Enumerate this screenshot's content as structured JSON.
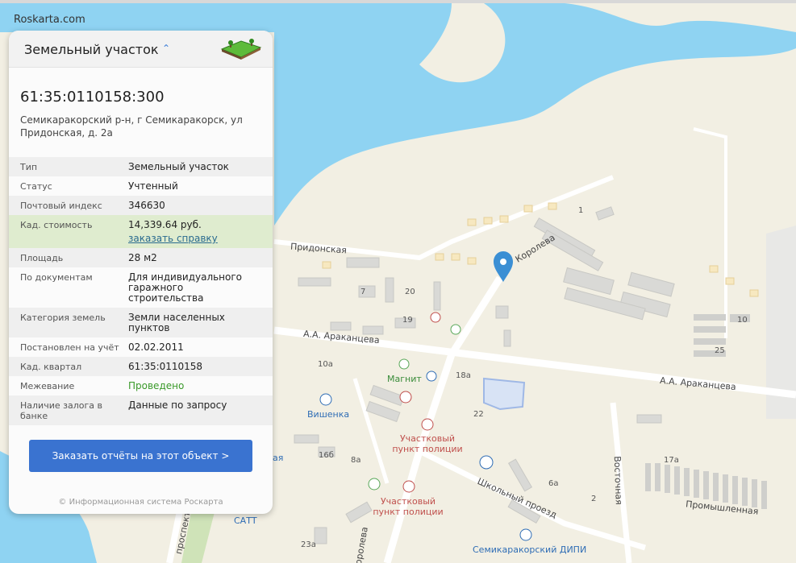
{
  "brand": "Roskarta.com",
  "panel": {
    "title": "Земельный участок",
    "cad_number": "61:35:0110158:300",
    "address": "Семикаракорский р-н, г Семикаракорск, ул Придонская, д. 2а",
    "properties": [
      {
        "label": "Тип",
        "value": "Земельный участок"
      },
      {
        "label": "Статус",
        "value": "Учтенный"
      },
      {
        "label": "Почтовый индекс",
        "value": "346630"
      },
      {
        "label": "Кад. стоимость",
        "value": "14,339.64 руб.",
        "link": "заказать справку"
      },
      {
        "label": "Площадь",
        "value": "28 м2"
      },
      {
        "label": "По документам",
        "value": "Для индивидуального гаражного строительства"
      },
      {
        "label": "Категория земель",
        "value": "Земли населенных пунктов"
      },
      {
        "label": "Постановлен на учёт",
        "value": "02.02.2011"
      },
      {
        "label": "Кад. квартал",
        "value": "61:35:0110158"
      },
      {
        "label": "Межевание",
        "value": "Проведено"
      },
      {
        "label": "Наличие залога в банке",
        "value": "Данные по запросу"
      }
    ],
    "order_button": "Заказать отчёты на этот объект >",
    "footer": "© Информационная система Роскарта"
  },
  "map": {
    "streets": {
      "pridonskaya": "Придонская",
      "korolyova": "Королева",
      "arakantseva_1": "А.А. Араканцева",
      "arakantseva_2": "А.А. Араканцева",
      "shkolny": "Школьный проезд",
      "vostochnaya": "Восточная",
      "promyshlennaya": "Промышленная",
      "prospekt": "проспект",
      "korolyova_2": "Королева"
    },
    "pois": {
      "magnit": "Магнит",
      "vishenka": "Вишенка",
      "police_1": "Участковый пункт полиции",
      "police_2": "Участковый пункт полиции",
      "satt": "САТТ",
      "dipi": "Семикаракорский ДИПИ",
      "edge_blue": "ая"
    },
    "house_numbers": {
      "n7": "7",
      "n20": "20",
      "n19": "19",
      "n10a": "10а",
      "n18a": "18а",
      "n22": "22",
      "n16b": "16б",
      "n8a": "8а",
      "n6a": "6а",
      "n2": "2",
      "n23a": "23а",
      "n10": "10",
      "n25": "25",
      "n1": "1",
      "n17a": "17а"
    },
    "colors": {
      "water": "#8fd3f2",
      "land": "#f2efe3",
      "road": "#ffffff",
      "building": "#d9d9d6",
      "marker": "#3b8fd4"
    }
  }
}
